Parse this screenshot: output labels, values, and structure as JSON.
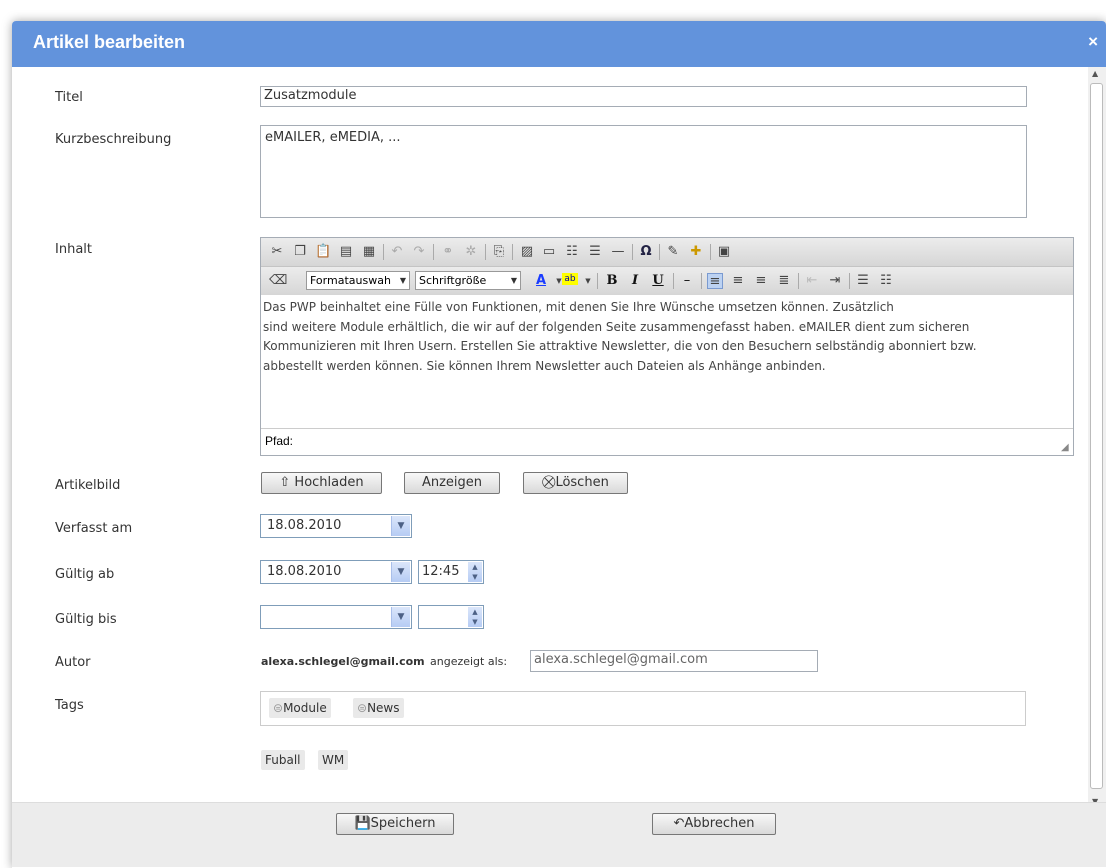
{
  "dialog": {
    "title": "Artikel bearbeiten",
    "close_label": "×"
  },
  "labels": {
    "titel": "Titel",
    "kurz": "Kurzbeschreibung",
    "inhalt": "Inhalt",
    "artikelbild": "Artikelbild",
    "verfasst": "Verfasst am",
    "gueltig_ab": "Gültig ab",
    "gueltig_bis": "Gültig bis",
    "autor": "Autor",
    "tags": "Tags"
  },
  "fields": {
    "titel": "Zusatzmodule",
    "kurz": "eMAILER, eMEDIA, ..."
  },
  "editor": {
    "format_select": "Formatauswah",
    "size_select": "Schriftgröße",
    "content": [
      "Das PWP beinhaltet eine Fülle von Funktionen, mit denen Sie Ihre Wünsche umsetzen können. Zusätzlich",
      "sind weitere Module erhältlich, die wir auf der folgenden Seite zusammengefasst haben. eMAILER dient zum sicheren",
      "Kommunizieren mit Ihren Usern. Erstellen Sie attraktive Newsletter, die von den Besuchern selbständig abonniert bzw.",
      "abbestellt werden können. Sie können Ihrem Newsletter auch Dateien als Anhänge anbinden."
    ],
    "path_label": "Pfad:",
    "toolbar1_icons": [
      "cut-icon",
      "copy-icon",
      "paste-icon",
      "paste-text-icon",
      "paste-word-icon",
      "undo-icon",
      "redo-icon",
      "link-icon",
      "unlink-icon",
      "attachment-icon",
      "image-icon",
      "insert-table-icon",
      "insert-row-icon",
      "insert-column-icon",
      "horizontal-rule-icon",
      "special-char-icon",
      "edit-icon",
      "insert-object-icon",
      "template-icon"
    ],
    "toolbar2_icons": [
      "eraser-icon",
      "font-color-icon",
      "highlight-color-icon",
      "bold-icon",
      "italic-icon",
      "underline-icon",
      "strike-icon",
      "align-left-icon",
      "align-center-icon",
      "align-right-icon",
      "align-justify-icon",
      "outdent-icon",
      "indent-icon",
      "ordered-list-icon",
      "unordered-list-icon"
    ]
  },
  "buttons": {
    "upload": "Hochladen",
    "show": "Anzeigen",
    "delete": "Löschen",
    "save": "Speichern",
    "cancel": "Abbrechen"
  },
  "dates": {
    "verfasst": "18.08.2010",
    "ab_date": "18.08.2010",
    "ab_time": "12:45",
    "bis_date": "",
    "bis_time": ""
  },
  "author": {
    "email": "alexa.schlegel@gmail.com",
    "shown_as_label": "angezeigt als:",
    "shown_as_value": "alexa.schlegel@gmail.com"
  },
  "tags": {
    "selected": [
      "Module",
      "News"
    ],
    "available": [
      "Fuball",
      "WM"
    ]
  },
  "colors": {
    "titlebar": "#6293dc",
    "font_color_bar": "#1a3cff",
    "highlight_bar": "#ffff00"
  }
}
